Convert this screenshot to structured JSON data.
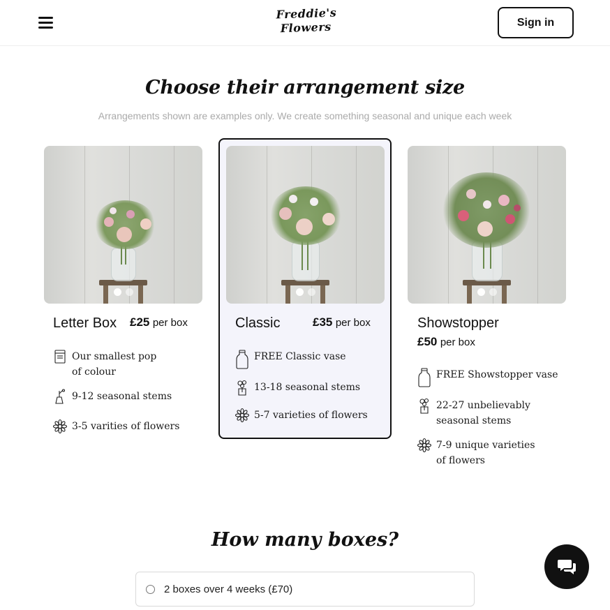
{
  "header": {
    "logo": {
      "line1": "Freddie's",
      "line2": "Flowers"
    },
    "signin_label": "Sign in"
  },
  "main": {
    "title": "Choose their arrangement size",
    "subtitle": "Arrangements shown are examples only. We create something seasonal and unique each week"
  },
  "cards": [
    {
      "name": "Letter Box",
      "price": "£25",
      "per": "per box",
      "selected": false,
      "features": [
        {
          "icon": "letterbox-icon",
          "line1": "Our smallest pop",
          "line2": "of colour"
        },
        {
          "icon": "stems-icon",
          "line1": "9-12 seasonal stems",
          "line2": ""
        },
        {
          "icon": "flower-icon",
          "line1": "3-5 varities of flowers",
          "line2": ""
        }
      ]
    },
    {
      "name": "Classic",
      "price": "£35",
      "per": "per box",
      "selected": true,
      "features": [
        {
          "icon": "vase-icon",
          "line1": "FREE Classic vase",
          "line2": ""
        },
        {
          "icon": "bouquet-icon",
          "line1": "13-18 seasonal stems",
          "line2": ""
        },
        {
          "icon": "flower-icon",
          "line1": "5-7 varieties of flowers",
          "line2": ""
        }
      ]
    },
    {
      "name": "Showstopper",
      "price": "£50",
      "per": "per box",
      "selected": false,
      "features": [
        {
          "icon": "vase-icon",
          "line1": "FREE Showstopper vase",
          "line2": ""
        },
        {
          "icon": "bouquet-icon",
          "line1": "22-27 unbelievably",
          "line2": "seasonal stems"
        },
        {
          "icon": "flower-icon",
          "line1": "7-9 unique varieties",
          "line2": "of flowers"
        }
      ]
    }
  ],
  "boxes": {
    "title": "How many boxes?",
    "options": [
      {
        "label": "2 boxes over 4 weeks (£70)",
        "checked": false
      }
    ]
  },
  "colors": {
    "text": "#111111",
    "muted": "#aaaaaa",
    "selected_bg": "#f4f4fb",
    "border": "#d9d9d9"
  }
}
